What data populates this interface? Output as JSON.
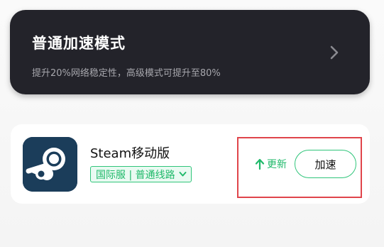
{
  "mode_card": {
    "title": "普通加速模式",
    "description": "提升20%网络稳定性，高级模式可提升至80%",
    "icon": "chevron-right-icon"
  },
  "game": {
    "name": "Steam移动版",
    "icon": "steam-logo",
    "server_tag": "国际服 | 普通线路",
    "server_tag_icon": "chevron-down-icon",
    "update_label": "更新",
    "update_icon": "arrow-up-icon",
    "accelerate_label": "加速"
  },
  "colors": {
    "accent_green": "#1fb96a",
    "dark_card": "#23232a",
    "highlight_red": "#e0454b",
    "steam_blue": "#1b3d5a"
  }
}
